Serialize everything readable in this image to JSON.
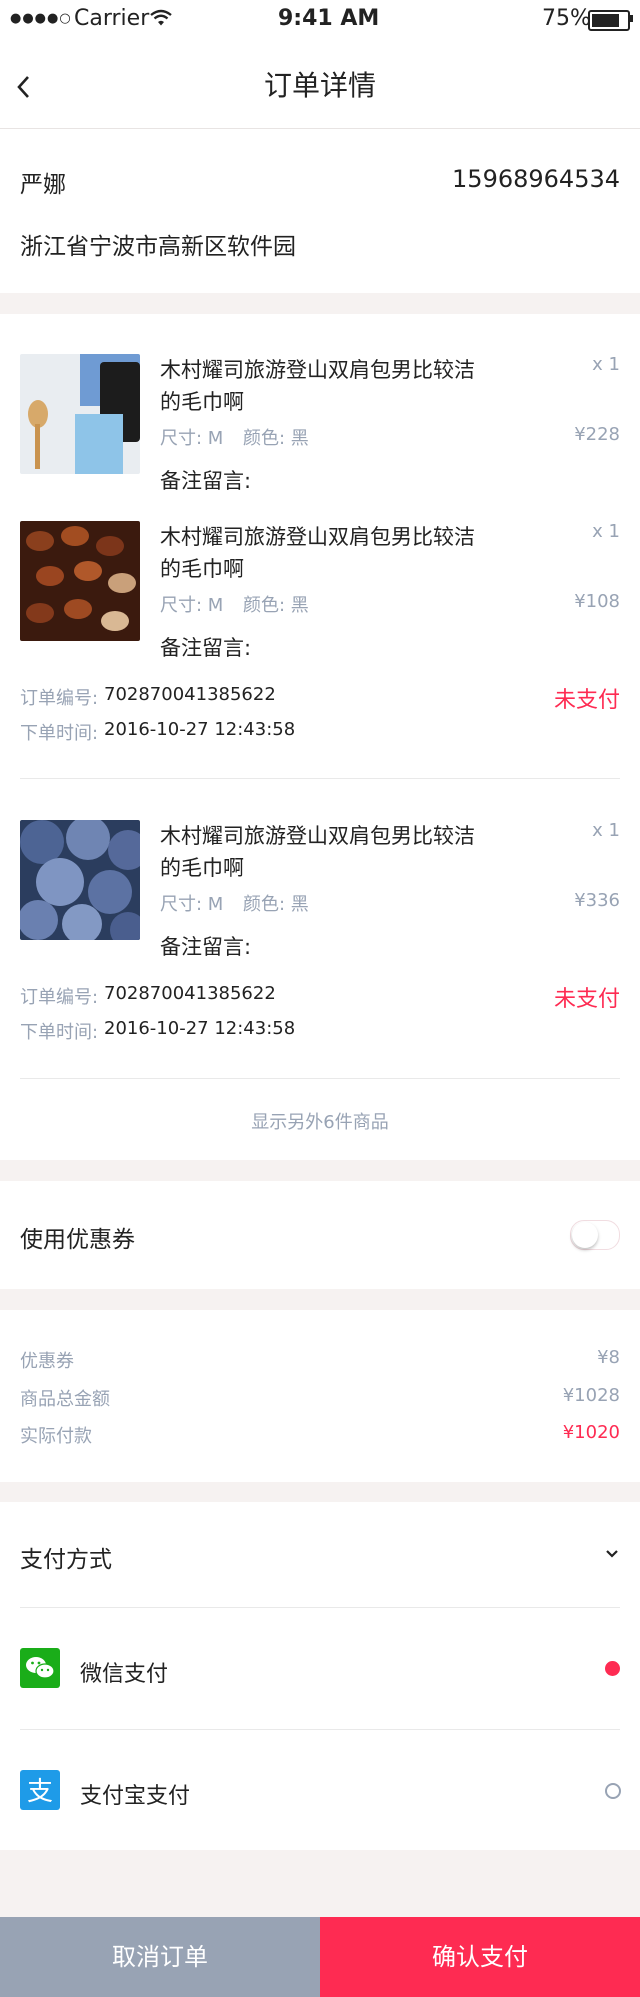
{
  "status": {
    "carrier": "Carrier",
    "time": "9:41 AM",
    "battery": "75%"
  },
  "nav": {
    "back_icon": "chevron-left-icon",
    "title": "订单详情"
  },
  "address": {
    "name": "严娜",
    "phone": "15968964534",
    "address": "浙江省宁波市高新区软件园"
  },
  "products": [
    {
      "title": "木村耀司旅游登山双肩包男比较洁的毛巾啊",
      "qty": "x 1",
      "size": "尺寸: M",
      "color": "颜色: 黑",
      "price": "¥228",
      "note": "备注留言:",
      "image": "spoon-wallet-image"
    },
    {
      "title": "木村耀司旅游登山双肩包男比较洁的毛巾啊",
      "qty": "x 1",
      "size": "尺寸: M",
      "color": "颜色: 黑",
      "price": "¥108",
      "note": "备注留言:",
      "image": "coffee-beans-image"
    },
    {
      "title": "木村耀司旅游登山双肩包男比较洁的毛巾啊",
      "qty": "x 1",
      "size": "尺寸: M",
      "color": "颜色: 黑",
      "price": "¥336",
      "note": "备注留言:",
      "image": "blueberries-image"
    }
  ],
  "orders": [
    {
      "no_label": "订单编号:",
      "no": "702870041385622",
      "time_label": "下单时间:",
      "time": "2016-10-27 12:43:58",
      "status": "未支付"
    },
    {
      "no_label": "订单编号:",
      "no": "702870041385622",
      "time_label": "下单时间:",
      "time": "2016-10-27 12:43:58",
      "status": "未支付"
    }
  ],
  "more_items": "显示另外6件商品",
  "coupon": {
    "label": "使用优惠券",
    "enabled": false
  },
  "summary": {
    "coupon_label": "优惠券",
    "coupon_value": "¥8",
    "total_label": "商品总金额",
    "total_value": "¥1028",
    "pay_label": "实际付款",
    "pay_value": "¥1020"
  },
  "payment": {
    "label": "支付方式",
    "methods": [
      {
        "name": "微信支付",
        "icon": "wechat-icon",
        "selected": true,
        "brand_color": "#1aad19"
      },
      {
        "name": "支付宝支付",
        "icon": "alipay-icon",
        "selected": false,
        "brand_color": "#1e9be8"
      }
    ]
  },
  "actions": {
    "cancel": "取消订单",
    "confirm": "确认支付"
  },
  "colors": {
    "accent": "#fe2b52",
    "cancel_bg": "#98a3b4",
    "muted": "#98a3b4"
  }
}
